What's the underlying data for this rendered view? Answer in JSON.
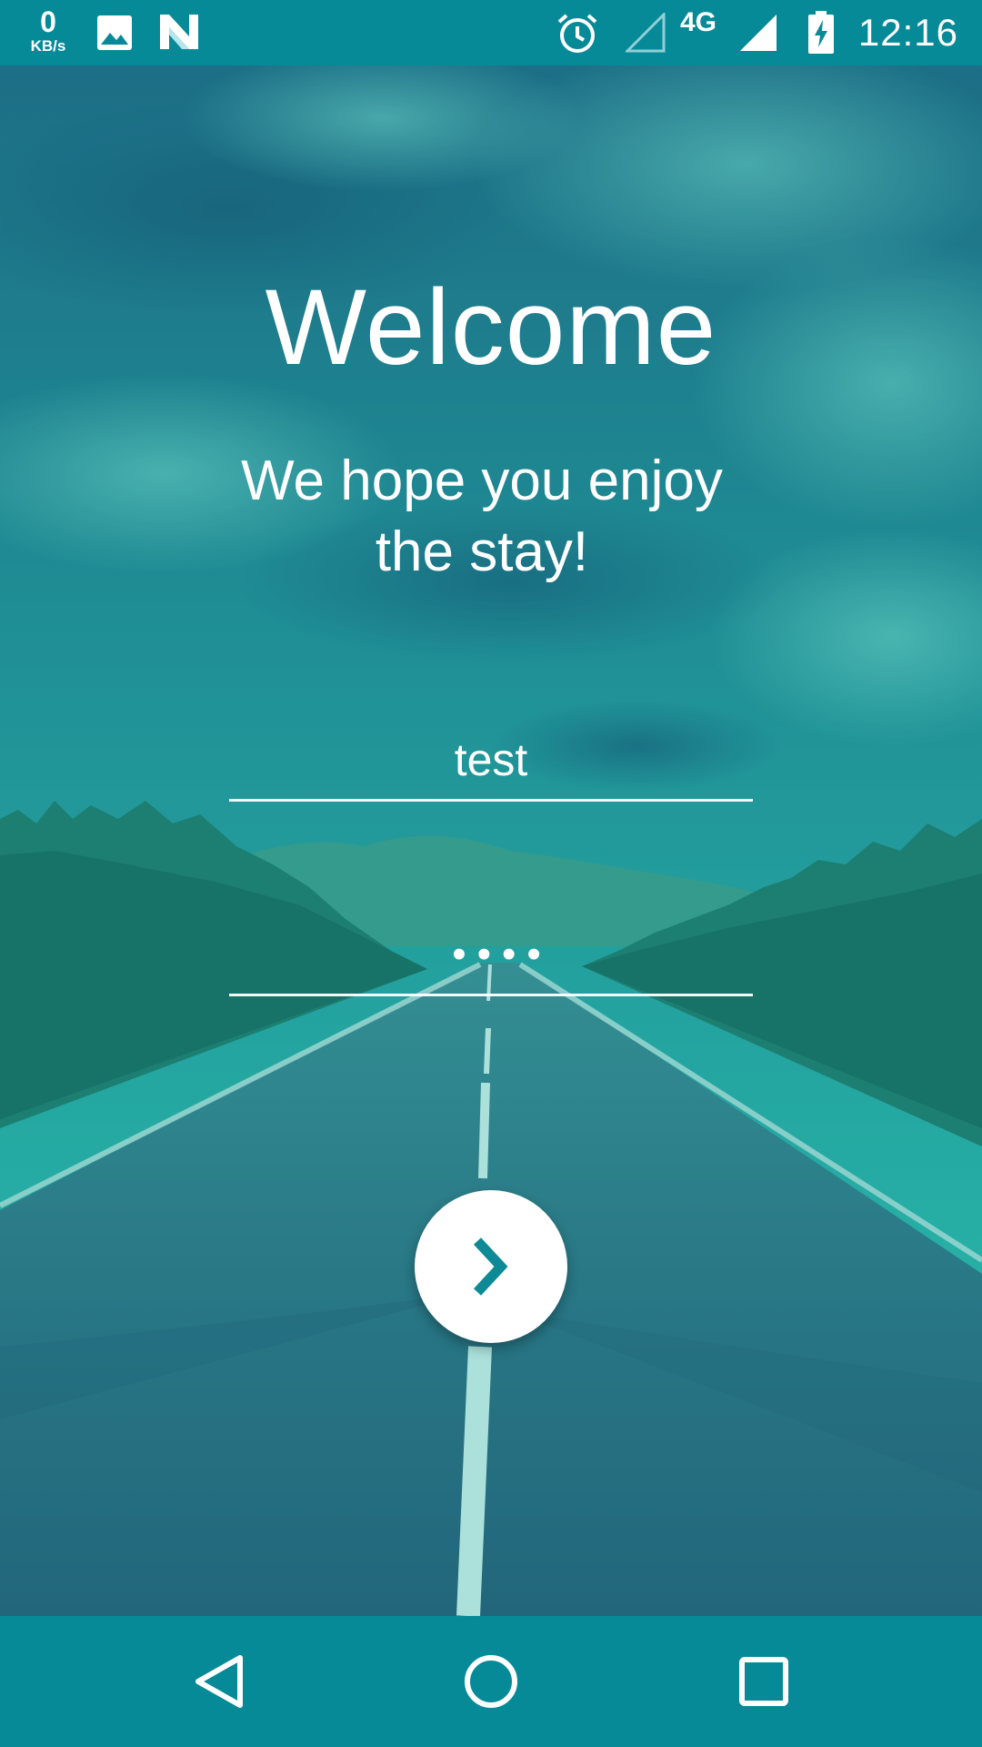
{
  "status_bar": {
    "net_speed_value": "0",
    "net_speed_unit": "KB/s",
    "network_type": "4G",
    "time": "12:16",
    "icons": [
      "image-icon",
      "n-logo-icon",
      "alarm-icon",
      "signal-empty-icon",
      "signal-icon",
      "battery-charging-icon"
    ]
  },
  "welcome": {
    "title": "Welcome",
    "subtitle": "We hope you enjoy the stay!"
  },
  "login_form": {
    "username_value": "test",
    "password_value": "test"
  },
  "submit": {
    "icon": "chevron-right-icon"
  },
  "navigation": {
    "icons": [
      "back-icon",
      "home-icon",
      "recents-icon"
    ]
  },
  "colors": {
    "accent": "#078a98",
    "overlay": "#12a3a3",
    "text": "#ffffff"
  }
}
